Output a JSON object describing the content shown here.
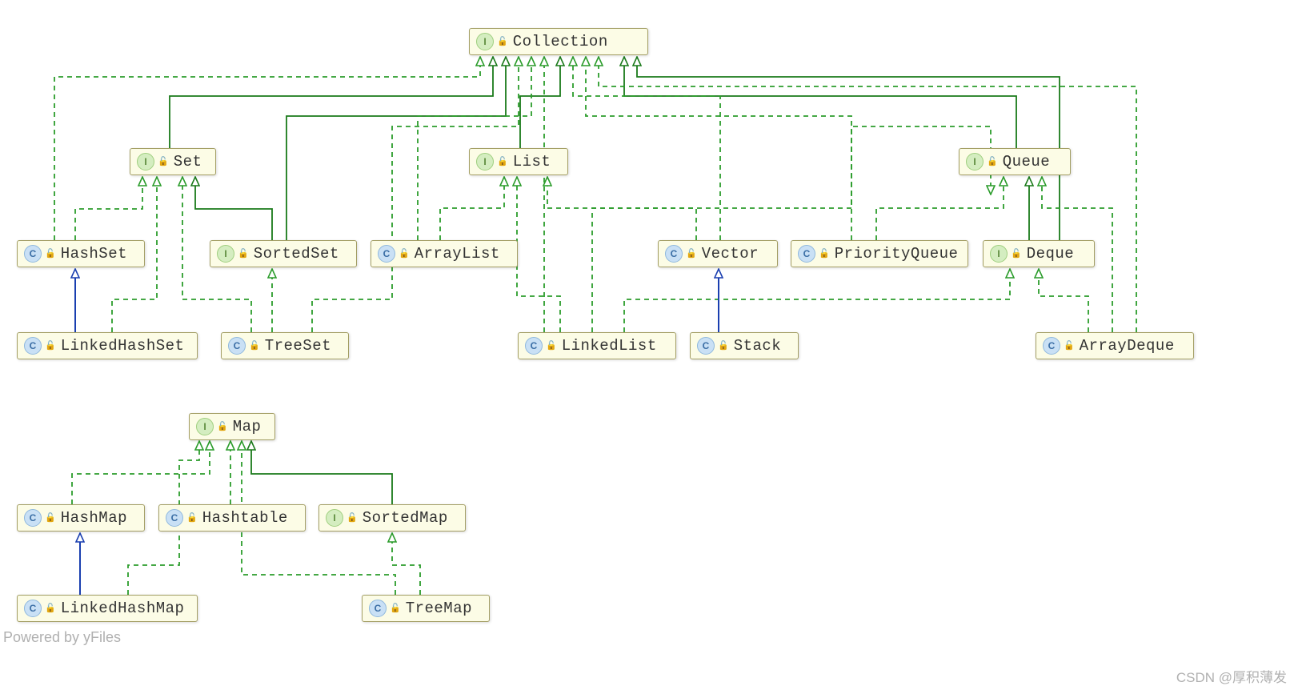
{
  "nodes": {
    "collection": {
      "label": "Collection",
      "type": "I"
    },
    "set": {
      "label": "Set",
      "type": "I"
    },
    "list": {
      "label": "List",
      "type": "I"
    },
    "queue": {
      "label": "Queue",
      "type": "I"
    },
    "hashset": {
      "label": "HashSet",
      "type": "C"
    },
    "sortedset": {
      "label": "SortedSet",
      "type": "I"
    },
    "arraylist": {
      "label": "ArrayList",
      "type": "C"
    },
    "vector": {
      "label": "Vector",
      "type": "C"
    },
    "priorityqueue": {
      "label": "PriorityQueue",
      "type": "C"
    },
    "deque": {
      "label": "Deque",
      "type": "I"
    },
    "linkedhashset": {
      "label": "LinkedHashSet",
      "type": "C"
    },
    "treeset": {
      "label": "TreeSet",
      "type": "C"
    },
    "linkedlist": {
      "label": "LinkedList",
      "type": "C"
    },
    "stack": {
      "label": "Stack",
      "type": "C"
    },
    "arraydeque": {
      "label": "ArrayDeque",
      "type": "C"
    },
    "map": {
      "label": "Map",
      "type": "I"
    },
    "hashmap": {
      "label": "HashMap",
      "type": "C"
    },
    "hashtable": {
      "label": "Hashtable",
      "type": "C"
    },
    "sortedmap": {
      "label": "SortedMap",
      "type": "I"
    },
    "linkedhashmap": {
      "label": "LinkedHashMap",
      "type": "C"
    },
    "treemap": {
      "label": "TreeMap",
      "type": "C"
    }
  },
  "icons": {
    "I": "I",
    "C": "C",
    "lock": "🔓"
  },
  "footer": {
    "powered": "Powered by yFiles",
    "watermark": "CSDN @厚积薄发"
  },
  "colors": {
    "node_bg": "#fcfce6",
    "node_border": "#a39e64",
    "solid_green": "#1a7a1a",
    "dashed_green": "#2b9c2b",
    "solid_blue": "#1a3fb0"
  }
}
